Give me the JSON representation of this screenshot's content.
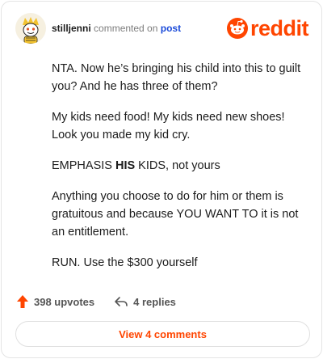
{
  "header": {
    "username": "stilljenni",
    "action": "commented on",
    "target": "post",
    "logo_text": "reddit"
  },
  "comment": {
    "p1": "NTA. Now he’s bringing his child into this to guilt you? And he has three of them?",
    "p2": "My kids need food! My kids need new shoes! Look you made my kid cry.",
    "p3_pre": "EMPHASIS ",
    "p3_bold": "HIS",
    "p3_post": " KIDS, not yours",
    "p4": "Anything you choose to do for him or them is gratuitous and because YOU WANT TO it is not an entitlement.",
    "p5": "RUN. Use the $300 yourself"
  },
  "footer": {
    "upvotes": "398 upvotes",
    "replies": "4 replies",
    "view_comments": "View 4 comments"
  },
  "colors": {
    "brand": "#ff4500",
    "link": "#1a4ad9"
  },
  "icons": {
    "avatar": "snoo-avatar-icon",
    "logo": "reddit-snoo-icon",
    "upvote": "upvote-arrow-icon",
    "reply": "reply-arrow-icon"
  }
}
